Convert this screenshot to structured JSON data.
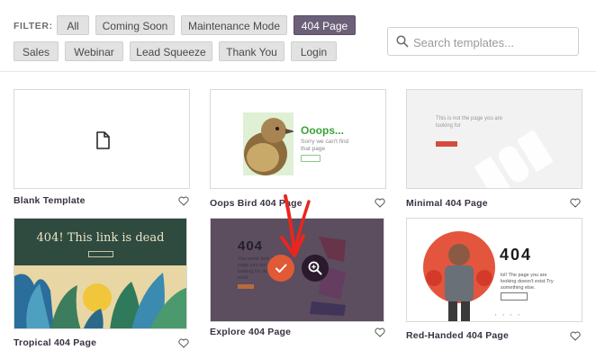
{
  "filter": {
    "label": "FILTER:",
    "options": [
      "All",
      "Coming Soon",
      "Maintenance Mode",
      "404 Page",
      "Sales",
      "Webinar",
      "Lead Squeeze",
      "Thank You",
      "Login"
    ],
    "active": "404 Page"
  },
  "search": {
    "placeholder": "Search templates..."
  },
  "templates": [
    {
      "title": "Blank Template"
    },
    {
      "title": "Oops Bird 404 Page",
      "heading": "Ooops...",
      "text": "Sorry we can't find that page"
    },
    {
      "title": "Minimal 404 Page",
      "text": "This is not the page you are looking for"
    },
    {
      "title": "Tropical 404 Page",
      "heading": "404! This link is dead"
    },
    {
      "title": "Explore 404 Page",
      "heading": "404",
      "text": "You seem lost. The page you are looking for doesn't exist."
    },
    {
      "title": "Red-Handed 404 Page",
      "heading": "404",
      "text": "lol! The page you are looking doesn't exist.Try something else."
    }
  ],
  "colors": {
    "active_filter": "#6c6079",
    "accent_red": "#d44c3b",
    "overlay_check": "#e05a35",
    "overlay_zoom": "#2b1a2e"
  },
  "icons": {
    "search": "search-icon",
    "blank": "document-icon",
    "favorite": "heart-outline-icon",
    "select": "checkmark-icon",
    "preview": "zoom-in-icon",
    "annotation": "red-arrow-icon"
  }
}
